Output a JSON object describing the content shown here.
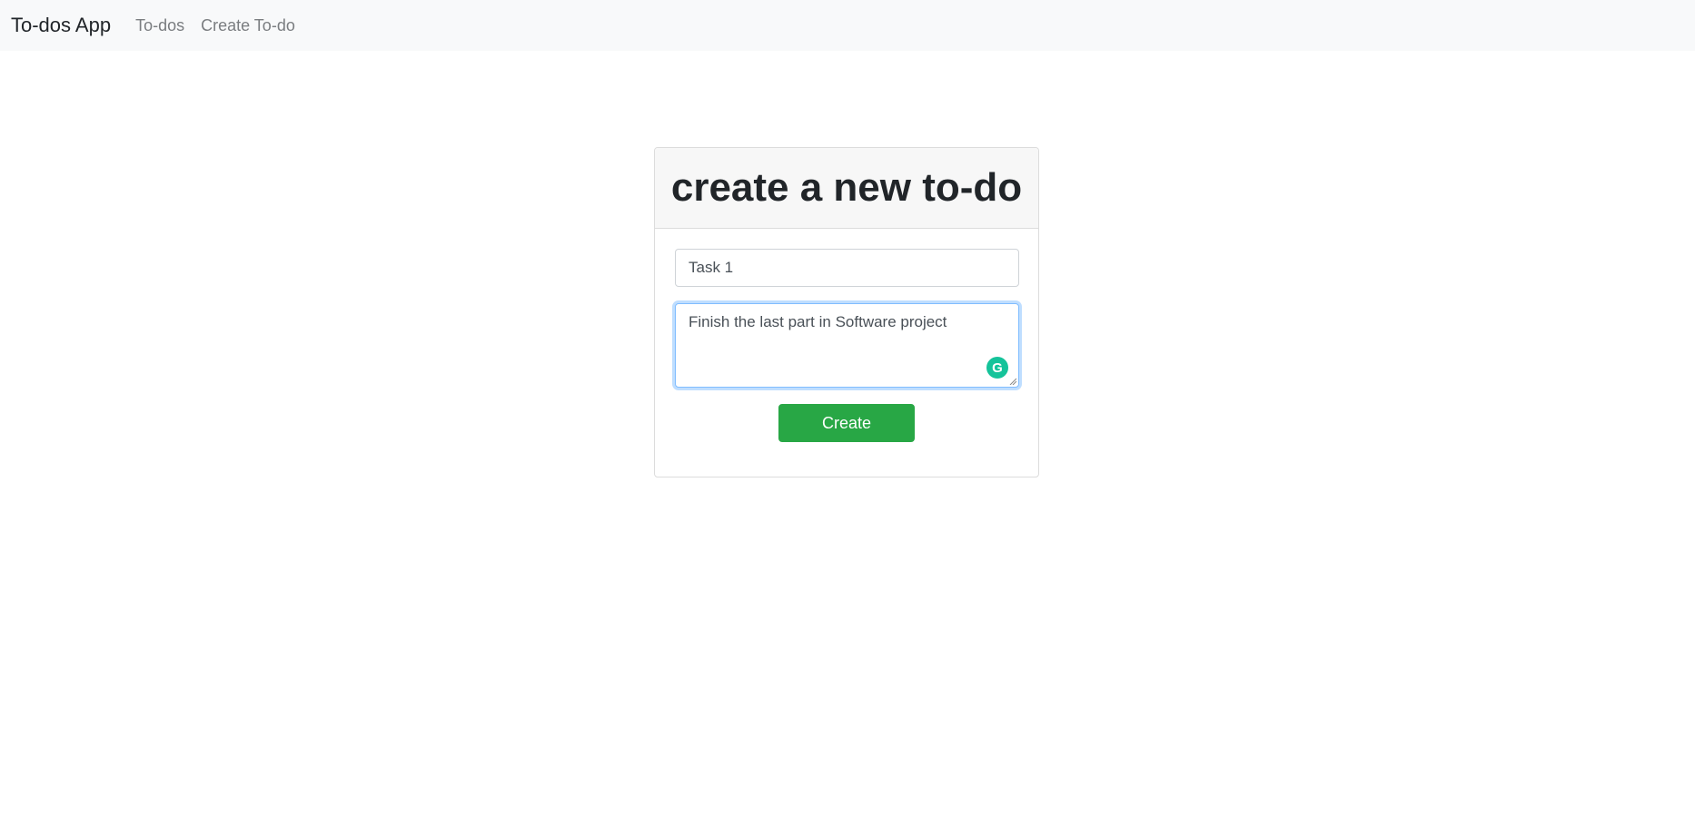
{
  "navbar": {
    "brand": "To-dos App",
    "links": [
      "To-dos",
      "Create To-do"
    ]
  },
  "card": {
    "title": "create a new to-do"
  },
  "form": {
    "title_value": "Task 1",
    "description_value": "Finish the last part in Software project",
    "create_label": "Create",
    "grammarly_glyph": "G"
  },
  "colors": {
    "navbar_bg": "#f8f9fa",
    "primary_button": "#28a745",
    "focus_border": "#80bdff",
    "grammarly": "#15c39a"
  },
  "icons": {
    "grammarly": "grammarly-icon"
  }
}
